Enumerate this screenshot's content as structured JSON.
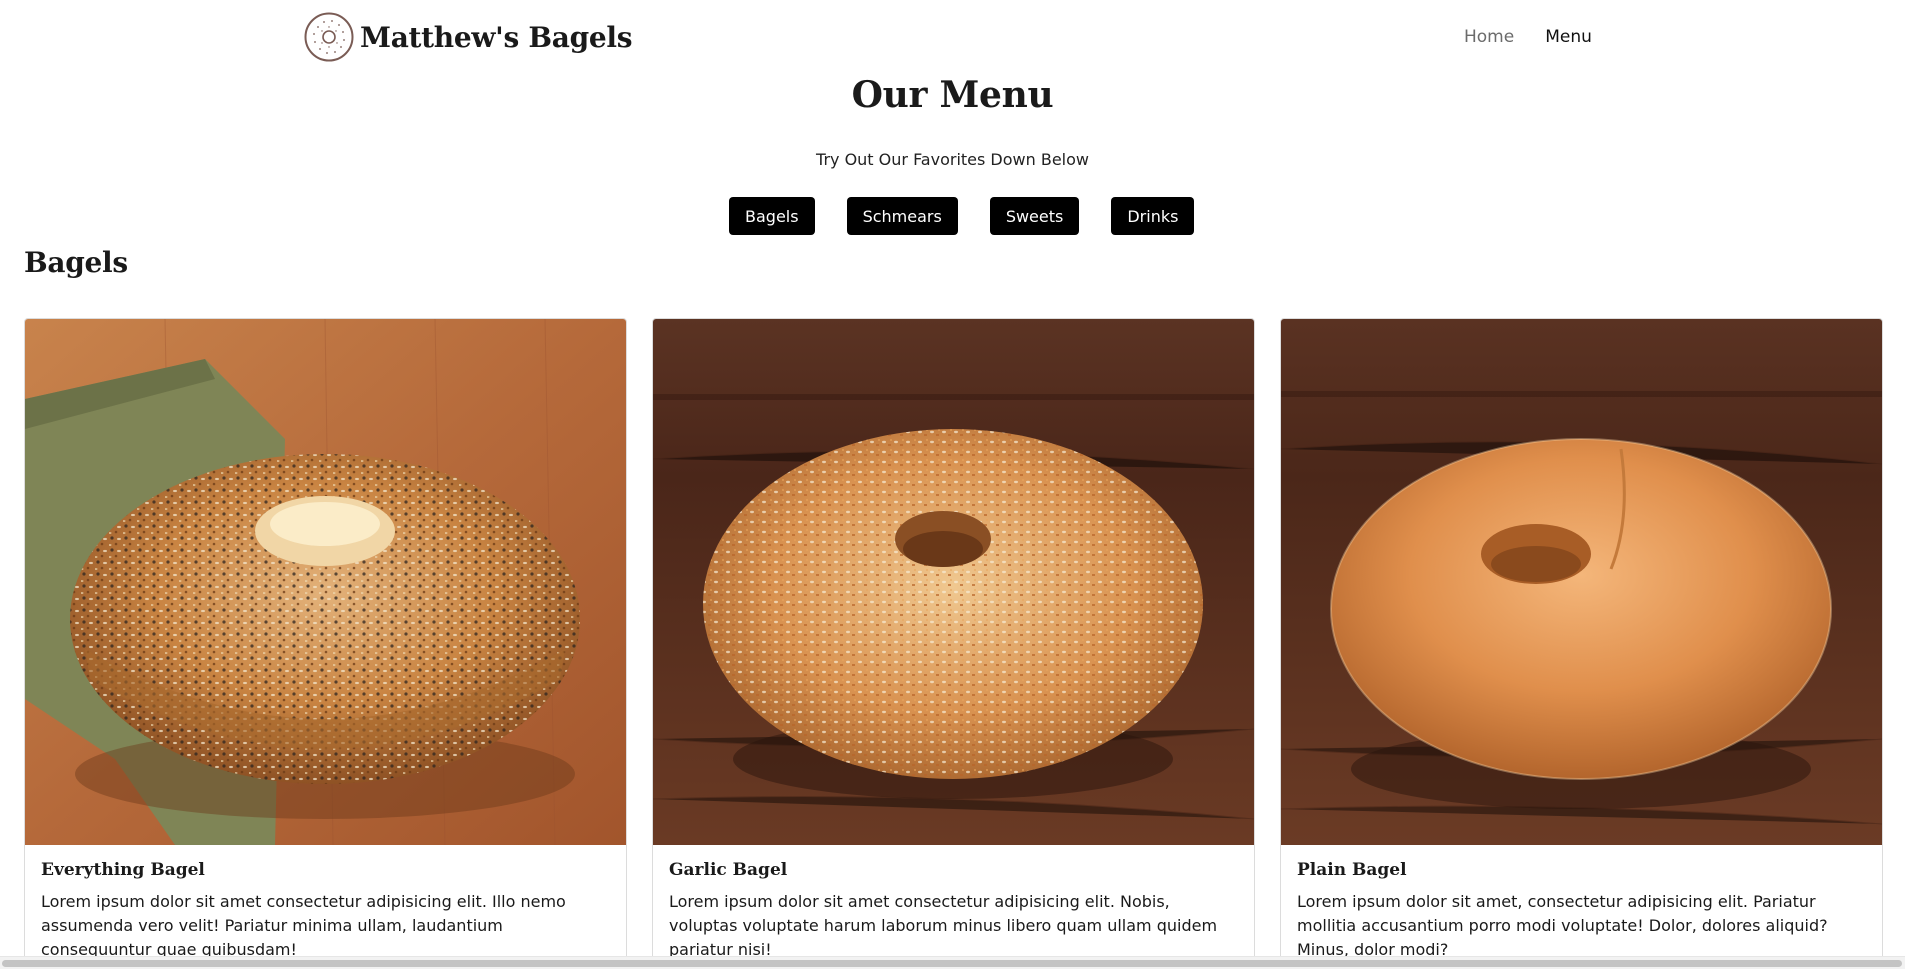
{
  "header": {
    "brand": "Matthew's Bagels",
    "logo_icon": "bagel-logo-icon",
    "nav": [
      {
        "label": "Home",
        "active": false
      },
      {
        "label": "Menu",
        "active": true
      }
    ]
  },
  "page": {
    "title": "Our Menu",
    "subtitle": "Try Out Our Favorites Down Below"
  },
  "filters": [
    "Bagels",
    "Schmears",
    "Sweets",
    "Drinks"
  ],
  "section": {
    "title": "Bagels"
  },
  "cards": [
    {
      "title": "Everything Bagel",
      "text": "Lorem ipsum dolor sit amet consectetur adipisicing elit. Illo nemo assumenda vero velit! Pariatur minima ullam, laudantium consequuntur quae quibusdam!",
      "image": "everything-bagel-photo"
    },
    {
      "title": "Garlic Bagel",
      "text": "Lorem ipsum dolor sit amet consectetur adipisicing elit. Nobis, voluptas voluptate harum laborum minus libero quam ullam quidem pariatur nisi!",
      "image": "garlic-bagel-photo"
    },
    {
      "title": "Plain Bagel",
      "text": "Lorem ipsum dolor sit amet, consectetur adipisicing elit. Pariatur mollitia accusantium porro modi voluptate! Dolor, dolores aliquid? Minus, dolor modi?",
      "image": "plain-bagel-photo"
    }
  ],
  "colors": {
    "button_bg": "#000000",
    "button_text": "#ffffff",
    "nav_inactive": "#6b6b6b",
    "wood_light": "#b9703c",
    "wood_dark": "#4a261a",
    "napkin": "#7f8556"
  }
}
